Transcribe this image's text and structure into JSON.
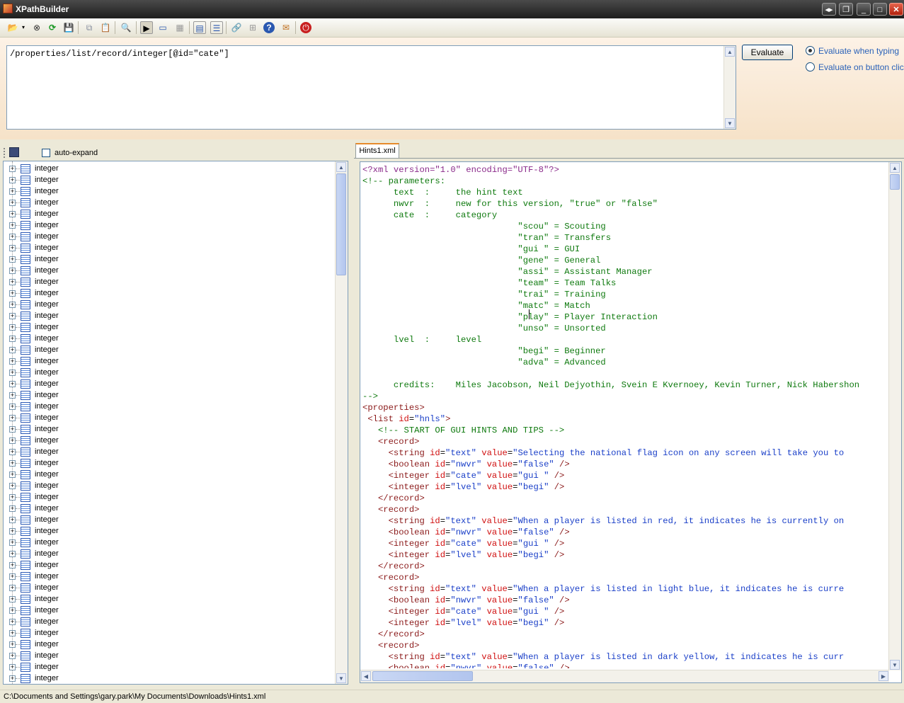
{
  "window": {
    "title": "XPathBuilder",
    "controls": [
      "◂▸",
      "❐",
      "_",
      "□",
      "✕"
    ]
  },
  "toolbar": {
    "items": [
      {
        "name": "open-icon",
        "glyph": "📂"
      },
      {
        "name": "stop-icon",
        "glyph": "⊗"
      },
      {
        "name": "refresh-icon",
        "glyph": "⟳"
      },
      {
        "name": "save-icon",
        "glyph": "💾"
      },
      {
        "name": "copy-icon",
        "glyph": "⧉"
      },
      {
        "name": "paste-icon",
        "glyph": "📋"
      },
      {
        "name": "find-icon",
        "glyph": "🔍"
      },
      {
        "name": "command-icon",
        "glyph": "▶"
      },
      {
        "name": "window-icon",
        "glyph": "▭"
      },
      {
        "name": "grid-icon",
        "glyph": "▦"
      },
      {
        "name": "tree-view-icon",
        "glyph": "▤"
      },
      {
        "name": "list-view-icon",
        "glyph": "☰"
      },
      {
        "name": "link-icon",
        "glyph": "🔗"
      },
      {
        "name": "network-icon",
        "glyph": "⊞"
      },
      {
        "name": "help-icon",
        "glyph": "?"
      },
      {
        "name": "folder-star-icon",
        "glyph": "✉"
      },
      {
        "name": "power-icon",
        "glyph": "⏻"
      }
    ]
  },
  "xpath": {
    "expression": "/properties/list/record/integer[@id=\"cate\"]",
    "evaluate_label": "Evaluate",
    "option_typing": "Evaluate when typing",
    "option_click": "Evaluate on button click",
    "selected_option": "typing"
  },
  "tree": {
    "auto_expand_label": "auto-expand",
    "auto_expand_checked": false,
    "node_label": "integer",
    "node_count": 46
  },
  "editor": {
    "tab_label": "Hints1.xml",
    "lines": [
      [
        [
          "pi",
          "<?xml version=\"1.0\" encoding=\"UTF-8\"?>"
        ]
      ],
      [
        [
          "cm",
          "<!-- parameters:"
        ]
      ],
      [
        [
          "cm",
          "      text  :     the hint text"
        ]
      ],
      [
        [
          "cm",
          "      nwvr  :     new for this version, \"true\" or \"false\""
        ]
      ],
      [
        [
          "cm",
          "      cate  :     category"
        ]
      ],
      [
        [
          "cm",
          "                              \"scou\" = Scouting"
        ]
      ],
      [
        [
          "cm",
          "                              \"tran\" = Transfers"
        ]
      ],
      [
        [
          "cm",
          "                              \"gui \" = GUI"
        ]
      ],
      [
        [
          "cm",
          "                              \"gene\" = General"
        ]
      ],
      [
        [
          "cm",
          "                              \"assi\" = Assistant Manager"
        ]
      ],
      [
        [
          "cm",
          "                              \"team\" = Team Talks"
        ]
      ],
      [
        [
          "cm",
          "                              \"trai\" = Training"
        ]
      ],
      [
        [
          "cm",
          "                              \"matc\" = Match"
        ]
      ],
      [
        [
          "cm",
          "                              \"play\" = Player Interaction"
        ]
      ],
      [
        [
          "cm",
          "                              \"unso\" = Unsorted"
        ]
      ],
      [
        [
          "cm",
          "      lvel  :     level"
        ]
      ],
      [
        [
          "cm",
          "                              \"begi\" = Beginner"
        ]
      ],
      [
        [
          "cm",
          "                              \"adva\" = Advanced"
        ]
      ],
      [
        [
          "cm",
          ""
        ]
      ],
      [
        [
          "cm",
          "      credits:    Miles Jacobson, Neil Dejyothin, Svein E Kvernoey, Kevin Turner, Nick Habershon"
        ]
      ],
      [
        [
          "cm",
          "-->"
        ]
      ],
      [
        [
          "tg",
          "<properties>"
        ]
      ],
      [
        [
          "tg",
          " <list "
        ],
        [
          "at",
          "id"
        ],
        [
          "tx",
          "="
        ],
        [
          "vl",
          "\"hnls\""
        ],
        [
          "tg",
          ">"
        ]
      ],
      [
        [
          "cm",
          "   <!-- START OF GUI HINTS AND TIPS -->"
        ]
      ],
      [
        [
          "tg",
          "   <record>"
        ]
      ],
      [
        [
          "tg",
          "     <string "
        ],
        [
          "at",
          "id"
        ],
        [
          "tx",
          "="
        ],
        [
          "vl",
          "\"text\""
        ],
        [
          "tx",
          " "
        ],
        [
          "at",
          "value"
        ],
        [
          "tx",
          "="
        ],
        [
          "vl",
          "\"Selecting the national flag icon on any screen will take you to"
        ]
      ],
      [
        [
          "tg",
          "     <boolean "
        ],
        [
          "at",
          "id"
        ],
        [
          "tx",
          "="
        ],
        [
          "vl",
          "\"nwvr\""
        ],
        [
          "tx",
          " "
        ],
        [
          "at",
          "value"
        ],
        [
          "tx",
          "="
        ],
        [
          "vl",
          "\"false\""
        ],
        [
          "tg",
          " />"
        ]
      ],
      [
        [
          "tg",
          "     <integer "
        ],
        [
          "at",
          "id"
        ],
        [
          "tx",
          "="
        ],
        [
          "vl",
          "\"cate\""
        ],
        [
          "tx",
          " "
        ],
        [
          "at",
          "value"
        ],
        [
          "tx",
          "="
        ],
        [
          "vl",
          "\"gui \""
        ],
        [
          "tg",
          " />"
        ]
      ],
      [
        [
          "tg",
          "     <integer "
        ],
        [
          "at",
          "id"
        ],
        [
          "tx",
          "="
        ],
        [
          "vl",
          "\"lvel\""
        ],
        [
          "tx",
          " "
        ],
        [
          "at",
          "value"
        ],
        [
          "tx",
          "="
        ],
        [
          "vl",
          "\"begi\""
        ],
        [
          "tg",
          " />"
        ]
      ],
      [
        [
          "tg",
          "   </record>"
        ]
      ],
      [
        [
          "tg",
          "   <record>"
        ]
      ],
      [
        [
          "tg",
          "     <string "
        ],
        [
          "at",
          "id"
        ],
        [
          "tx",
          "="
        ],
        [
          "vl",
          "\"text\""
        ],
        [
          "tx",
          " "
        ],
        [
          "at",
          "value"
        ],
        [
          "tx",
          "="
        ],
        [
          "vl",
          "\"When a player is listed in red, it indicates he is currently on"
        ]
      ],
      [
        [
          "tg",
          "     <boolean "
        ],
        [
          "at",
          "id"
        ],
        [
          "tx",
          "="
        ],
        [
          "vl",
          "\"nwvr\""
        ],
        [
          "tx",
          " "
        ],
        [
          "at",
          "value"
        ],
        [
          "tx",
          "="
        ],
        [
          "vl",
          "\"false\""
        ],
        [
          "tg",
          " />"
        ]
      ],
      [
        [
          "tg",
          "     <integer "
        ],
        [
          "at",
          "id"
        ],
        [
          "tx",
          "="
        ],
        [
          "vl",
          "\"cate\""
        ],
        [
          "tx",
          " "
        ],
        [
          "at",
          "value"
        ],
        [
          "tx",
          "="
        ],
        [
          "vl",
          "\"gui \""
        ],
        [
          "tg",
          " />"
        ]
      ],
      [
        [
          "tg",
          "     <integer "
        ],
        [
          "at",
          "id"
        ],
        [
          "tx",
          "="
        ],
        [
          "vl",
          "\"lvel\""
        ],
        [
          "tx",
          " "
        ],
        [
          "at",
          "value"
        ],
        [
          "tx",
          "="
        ],
        [
          "vl",
          "\"begi\""
        ],
        [
          "tg",
          " />"
        ]
      ],
      [
        [
          "tg",
          "   </record>"
        ]
      ],
      [
        [
          "tg",
          "   <record>"
        ]
      ],
      [
        [
          "tg",
          "     <string "
        ],
        [
          "at",
          "id"
        ],
        [
          "tx",
          "="
        ],
        [
          "vl",
          "\"text\""
        ],
        [
          "tx",
          " "
        ],
        [
          "at",
          "value"
        ],
        [
          "tx",
          "="
        ],
        [
          "vl",
          "\"When a player is listed in light blue, it indicates he is curre"
        ]
      ],
      [
        [
          "tg",
          "     <boolean "
        ],
        [
          "at",
          "id"
        ],
        [
          "tx",
          "="
        ],
        [
          "vl",
          "\"nwvr\""
        ],
        [
          "tx",
          " "
        ],
        [
          "at",
          "value"
        ],
        [
          "tx",
          "="
        ],
        [
          "vl",
          "\"false\""
        ],
        [
          "tg",
          " />"
        ]
      ],
      [
        [
          "tg",
          "     <integer "
        ],
        [
          "at",
          "id"
        ],
        [
          "tx",
          "="
        ],
        [
          "vl",
          "\"cate\""
        ],
        [
          "tx",
          " "
        ],
        [
          "at",
          "value"
        ],
        [
          "tx",
          "="
        ],
        [
          "vl",
          "\"gui \""
        ],
        [
          "tg",
          " />"
        ]
      ],
      [
        [
          "tg",
          "     <integer "
        ],
        [
          "at",
          "id"
        ],
        [
          "tx",
          "="
        ],
        [
          "vl",
          "\"lvel\""
        ],
        [
          "tx",
          " "
        ],
        [
          "at",
          "value"
        ],
        [
          "tx",
          "="
        ],
        [
          "vl",
          "\"begi\""
        ],
        [
          "tg",
          " />"
        ]
      ],
      [
        [
          "tg",
          "   </record>"
        ]
      ],
      [
        [
          "tg",
          "   <record>"
        ]
      ],
      [
        [
          "tg",
          "     <string "
        ],
        [
          "at",
          "id"
        ],
        [
          "tx",
          "="
        ],
        [
          "vl",
          "\"text\""
        ],
        [
          "tx",
          " "
        ],
        [
          "at",
          "value"
        ],
        [
          "tx",
          "="
        ],
        [
          "vl",
          "\"When a player is listed in dark yellow, it indicates he is curr"
        ]
      ],
      [
        [
          "tg",
          "     <boolean "
        ],
        [
          "at",
          "id"
        ],
        [
          "tx",
          "="
        ],
        [
          "vl",
          "\"nwvr\""
        ],
        [
          "tx",
          " "
        ],
        [
          "at",
          "value"
        ],
        [
          "tx",
          "="
        ],
        [
          "vl",
          "\"false\""
        ],
        [
          "tg",
          " />"
        ]
      ]
    ]
  },
  "status": {
    "path": "C:\\Documents and Settings\\gary.park\\My Documents\\Downloads\\Hints1.xml"
  },
  "colors": {
    "comment": "#0f7a0f",
    "tag": "#8b1a1a",
    "attribute": "#d01010",
    "value": "#1a3fc8",
    "titlebar": "#2a2a2a"
  }
}
